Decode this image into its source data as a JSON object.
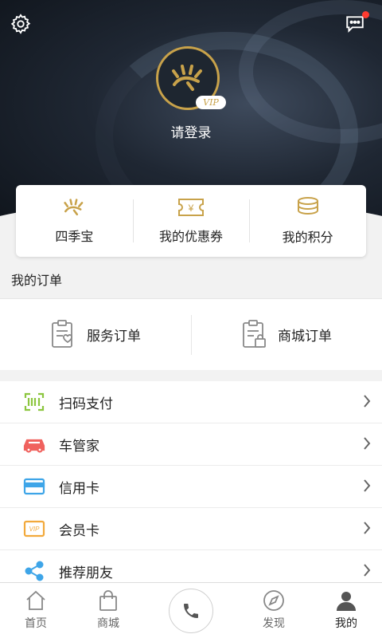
{
  "header": {
    "settings_icon": "gear-icon",
    "messages_icon": "chat-bubble-icon",
    "has_unread": true,
    "vip_badge": "VIP",
    "login_label": "请登录"
  },
  "quick_links": [
    {
      "label": "四季宝",
      "icon": "sun-rays-icon"
    },
    {
      "label": "我的优惠券",
      "icon": "coupon-yen-icon"
    },
    {
      "label": "我的积分",
      "icon": "coin-stack-icon"
    }
  ],
  "orders": {
    "title": "我的订单",
    "items": [
      {
        "label": "服务订单",
        "icon": "service-order-icon"
      },
      {
        "label": "商城订单",
        "icon": "mall-order-icon"
      }
    ]
  },
  "menu": [
    {
      "label": "扫码支付",
      "icon": "scan-code-icon",
      "color": "#8cc63f"
    },
    {
      "label": "车管家",
      "icon": "car-icon",
      "color": "#f0625e"
    },
    {
      "label": "信用卡",
      "icon": "credit-card-icon",
      "color": "#3ea5e8"
    },
    {
      "label": "会员卡",
      "icon": "vip-card-icon",
      "color": "#f2a93b"
    },
    {
      "label": "推荐朋友",
      "icon": "share-icon",
      "color": "#3ea5e8"
    }
  ],
  "tabbar": [
    {
      "label": "首页",
      "icon": "home-icon"
    },
    {
      "label": "商城",
      "icon": "shopping-bag-icon"
    },
    {
      "label": "",
      "icon": "phone-icon"
    },
    {
      "label": "发现",
      "icon": "compass-icon"
    },
    {
      "label": "我的",
      "icon": "user-icon",
      "active": true
    }
  ],
  "colors": {
    "gold": "#c8a24a",
    "unread_dot": "#ff3b30"
  }
}
